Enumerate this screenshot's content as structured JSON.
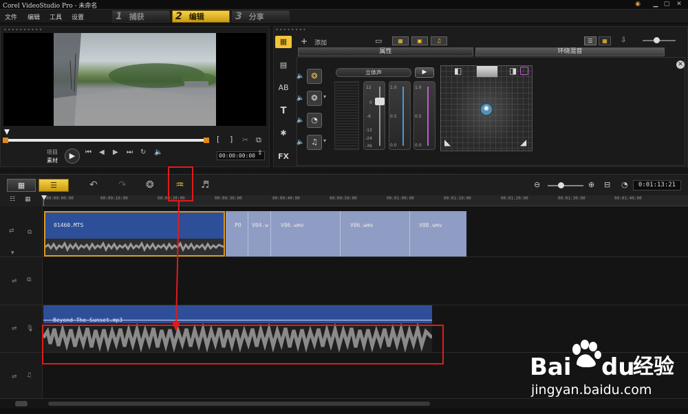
{
  "window": {
    "title": "Corel VideoStudio Pro - 未命名"
  },
  "menu": {
    "items": [
      "文件",
      "编辑",
      "工具",
      "设置"
    ]
  },
  "steps": [
    {
      "num": "1",
      "label": "捕获",
      "active": false
    },
    {
      "num": "2",
      "label": "编辑",
      "active": true
    },
    {
      "num": "3",
      "label": "分享",
      "active": false
    }
  ],
  "preview": {
    "mode_project": "项目",
    "mode_clip": "素材",
    "timecode": "00:00:00:00",
    "scrub_fraction": 0
  },
  "options": {
    "add_label": "添加",
    "tab_properties": "属性",
    "tab_mixer": "环绕混音",
    "stereo_label": "立体声",
    "vu_scale": [
      "12",
      "0",
      "-6",
      "-12",
      "-24",
      "-36"
    ],
    "channel_scale_a": [
      "1.0",
      "0.5",
      "0.0"
    ],
    "channel_scale_b": [
      "1.0",
      "0.5",
      "0.0"
    ],
    "side_icons": [
      "media-icon",
      "video-icon",
      "title-ab-icon",
      "text-t-icon",
      "graphic-icon",
      "fx-icon"
    ]
  },
  "timeline": {
    "timecode": "0:01:13:21",
    "ruler_labels": [
      "00:00:00:00",
      "00:00:10:00",
      "00:00:20:00",
      "00:00:30:00",
      "00:00:40:00",
      "00:00:50:00",
      "00:01:00:00",
      "00:01:10:00",
      "00:01:20:00",
      "00:01:30:00",
      "00:01:40:00"
    ],
    "video_clips": [
      {
        "name": "01460.MTS"
      },
      {
        "name": "PO"
      },
      {
        "name": "V04.w"
      },
      {
        "name": "V06.wmv"
      },
      {
        "name": "V06.wmv"
      },
      {
        "name": "V08.wmv"
      }
    ],
    "audio_clip": {
      "name": "Beyond-The-Sunset.mp3"
    }
  },
  "watermark": {
    "brand_latin": "Bai",
    "brand_latin2": "du",
    "brand_cn": "经验",
    "url": "jingyan.baidu.com"
  },
  "colors": {
    "accent": "#f2c43a",
    "clip_blue": "#2e4f98",
    "highlight_red": "#e21b1b"
  }
}
